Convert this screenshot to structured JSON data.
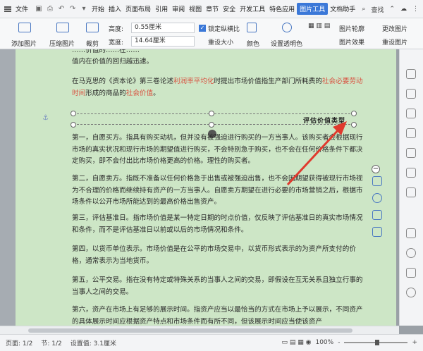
{
  "menubar": {
    "file": "文件",
    "items": [
      "开始",
      "插入",
      "页面布局",
      "引用",
      "审阅",
      "视图",
      "章节",
      "安全",
      "开发工具",
      "特色应用"
    ],
    "active_tab": "图片工具",
    "extra_tab": "文档助手",
    "search": "查找"
  },
  "toolbar": {
    "add_image": "添加图片",
    "compress": "压缩图片",
    "crop": "裁剪",
    "height_label": "高度:",
    "height_value": "0.55厘米",
    "width_label": "宽度:",
    "width_value": "14.64厘米",
    "lock_ratio": "锁定纵横比",
    "reset_size": "重设大小",
    "color": "颜色",
    "set_transparent": "设置透明色",
    "image_outline": "图片轮廓",
    "change_image": "更改图片",
    "image_effect": "图片效果",
    "reset_image": "重设图片"
  },
  "document": {
    "p0_line1": "……价值的……在……",
    "p0_line2": "值内在价值的回归越迅速。",
    "p1_pre": "在马克思的《资本论》第三卷论述",
    "p1_link1": "利润率平均化",
    "p1_mid": "时提出市场价值指生产部门所耗费的",
    "p1_link2": "社会必要劳动时间",
    "p1_mid2": "形成的商品的",
    "p1_link3": "社会价值",
    "p1_end": "。",
    "image_caption": "评估价值类型",
    "p2": "第一，自愿买方。指具有购买动机，但并没有被强迫进行购买的一方当事人。该购买者会根据现行市场的真实状况和现行市场的期望值进行购买，不会特别急于购买，也不会在任何价格条件下都决定购买，即不会付出比市场价格更高的价格。理性的购买者。",
    "p3": "第二，自愿卖方。指既不准备以任何价格急于出售或被强迫出售，也不会因期望获得被现行市场视为不合理的价格而继续持有资产的一方当事人。自愿卖方期望在进行必要的市场营销之后，根据市场条件以公开市场所能达到的最高价格出售资产。",
    "p4": "第三，评估基准日。指市场价值是某一特定日期的时点价值，仅反映了评估基准日的真实市场情况和条件，而不是评估基准日以前或以后的市场情况和条件。",
    "p5": "第四，以货币单位表示。市场价值是在公平的市场交易中，以货币形式表示的为资产所支付的价格，通常表示为当地货币。",
    "p6": "第五，公平交易。指在没有特定或特殊关系的当事人之间的交易，即假设在互无关系且独立行事的当事人之间的交易。",
    "p7": "第六，资产在市场上有足够的展示时间。指资产应当以最恰当的方式在市场上予以展示，不同资产的具体展示时间应根据资产特点和市场条件而有所不同，但该展示时间应当使该资产"
  },
  "status": {
    "page_num": "页面: 1/2",
    "section": "节: 1/2",
    "pos": "设置值: 3.1厘米",
    "zoom": "100%",
    "zoom_minus": "-",
    "zoom_plus": "+"
  },
  "colors": {
    "accent": "#3b78d8",
    "page_bg": "#cde6c6",
    "link": "#d9503f",
    "arrow": "#e03a2e"
  }
}
